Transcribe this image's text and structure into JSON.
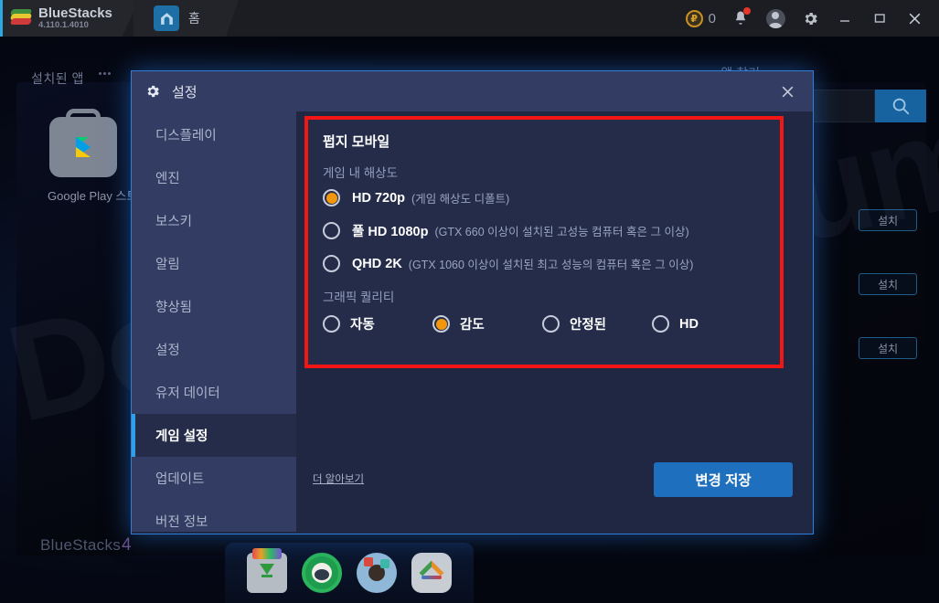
{
  "titlebar": {
    "brand_name": "BlueStacks",
    "brand_version": "4.110.1.4010",
    "stack_icon": "bluestacks-logo-icon",
    "tab": {
      "icon": "home-icon",
      "label": "홈"
    },
    "coin": {
      "icon": "points-coin-icon",
      "count": "0"
    },
    "bell_icon": "notification-bell-icon",
    "account_icon": "user-avatar-icon",
    "settings_icon": "gear-icon",
    "minimize_icon": "minimize-icon",
    "maximize_icon": "maximize-icon",
    "close_icon": "close-icon"
  },
  "background": {
    "installed_apps_label": "설치된 앱",
    "kebab_icon": "more-options-icon",
    "play_store": {
      "icon": "google-play-store-icon",
      "label": "Google Play 스토어"
    },
    "add_app_label": "앱 찾기",
    "search": {
      "icon": "search-icon",
      "value": "",
      "placeholder": ""
    },
    "install_buttons": [
      "설치",
      "설치",
      "설치"
    ],
    "bottom_logo": "BlueStacks",
    "bottom_logo_version": "4",
    "taskbar_icons": [
      "downloads-icon",
      "bluestacks-cafe-icon",
      "profile-app-icon",
      "bluestacks-app-icon"
    ],
    "watermark": "Downloadforum"
  },
  "dialog": {
    "header": {
      "icon": "gear-icon",
      "title": "설정",
      "close_icon": "close-icon"
    },
    "nav": [
      {
        "label": "디스플레이",
        "active": false
      },
      {
        "label": "엔진",
        "active": false
      },
      {
        "label": "보스키",
        "active": false
      },
      {
        "label": "알림",
        "active": false
      },
      {
        "label": "향상됨",
        "active": false
      },
      {
        "label": "설정",
        "active": false
      },
      {
        "label": "유저 데이터",
        "active": false
      },
      {
        "label": "게임 설정",
        "active": true
      },
      {
        "label": "업데이트",
        "active": false
      },
      {
        "label": "버전 정보",
        "active": false
      }
    ],
    "panel": {
      "group_title": "펍지 모바일",
      "resolution_label": "게임 내 해상도",
      "resolution_options": [
        {
          "main": "HD 720p",
          "sub": "(게임 해상도 디폴트)",
          "selected": true
        },
        {
          "main": "풀 HD 1080p",
          "sub": "(GTX 660 이상이 설치된 고성능 컴퓨터 혹은 그 이상)",
          "selected": false
        },
        {
          "main": "QHD 2K",
          "sub": "(GTX 1060 이상이 설치된 최고 성능의 컴퓨터 혹은 그 이상)",
          "selected": false
        }
      ],
      "quality_label": "그래픽 퀄리티",
      "quality_options": [
        {
          "main": "자동",
          "selected": false
        },
        {
          "main": "감도",
          "selected": true
        },
        {
          "main": "안정된",
          "selected": false
        },
        {
          "main": "HD",
          "selected": false
        }
      ],
      "highlight_color": "#f41515",
      "accent_color": "#f2960c"
    },
    "more_link": "더 알아보기",
    "save_label": "변경 저장"
  }
}
